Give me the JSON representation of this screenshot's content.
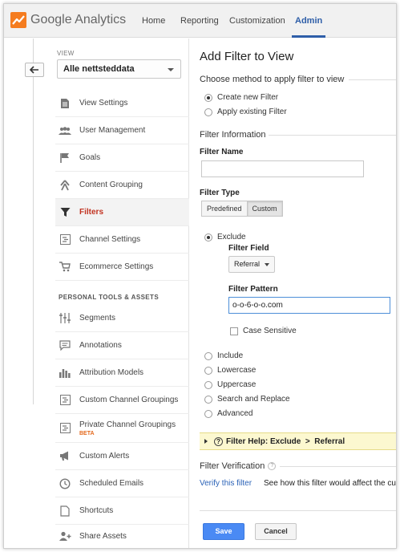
{
  "header": {
    "logo_text": "Google Analytics",
    "nav": [
      {
        "label": "Home"
      },
      {
        "label": "Reporting"
      },
      {
        "label": "Customization"
      },
      {
        "label": "Admin"
      }
    ],
    "active_nav": "Admin"
  },
  "sidebar": {
    "view_label": "VIEW",
    "view_value": "Alle nettsteddata",
    "items": [
      {
        "label": "View Settings",
        "icon": "document-icon"
      },
      {
        "label": "User Management",
        "icon": "users-icon"
      },
      {
        "label": "Goals",
        "icon": "flag-icon"
      },
      {
        "label": "Content Grouping",
        "icon": "person-walk-icon"
      },
      {
        "label": "Filters",
        "icon": "filter-icon"
      },
      {
        "label": "Channel Settings",
        "icon": "channel-icon"
      },
      {
        "label": "Ecommerce Settings",
        "icon": "cart-icon"
      }
    ],
    "section_title": "PERSONAL TOOLS & ASSETS",
    "personal_items": [
      {
        "label": "Segments",
        "icon": "segments-icon"
      },
      {
        "label": "Annotations",
        "icon": "comment-icon"
      },
      {
        "label": "Attribution Models",
        "icon": "bar-chart-icon"
      },
      {
        "label": "Custom Channel Groupings",
        "icon": "channel-icon"
      },
      {
        "label": "Private Channel Groupings",
        "icon": "channel-icon",
        "badge": "BETA"
      },
      {
        "label": "Custom Alerts",
        "icon": "megaphone-icon"
      },
      {
        "label": "Scheduled Emails",
        "icon": "clock-icon"
      },
      {
        "label": "Shortcuts",
        "icon": "shortcut-icon"
      },
      {
        "label": "Share Assets",
        "icon": "share-user-icon"
      }
    ]
  },
  "main": {
    "title": "Add Filter to View",
    "method_heading": "Choose method to apply filter to view",
    "method_options": [
      "Create new Filter",
      "Apply existing Filter"
    ],
    "method_selected": "Create new Filter",
    "info_heading": "Filter Information",
    "filter_name_label": "Filter Name",
    "filter_name_value": "",
    "filter_type_label": "Filter Type",
    "filter_type_tabs": [
      "Predefined",
      "Custom"
    ],
    "filter_type_selected": "Custom",
    "custom_options": [
      "Exclude",
      "Include",
      "Lowercase",
      "Uppercase",
      "Search and Replace",
      "Advanced"
    ],
    "custom_selected": "Exclude",
    "filter_field_label": "Filter Field",
    "filter_field_value": "Referral",
    "filter_pattern_label": "Filter Pattern",
    "filter_pattern_value": "o-o-6-o-o.com",
    "case_sensitive_label": "Case Sensitive",
    "case_sensitive": false,
    "help_bar": "Filter Help: Exclude  >  Referral",
    "verification_heading": "Filter Verification",
    "verify_link": "Verify this filter",
    "verify_desc": "See how this filter would affect the current",
    "save_label": "Save",
    "cancel_label": "Cancel"
  },
  "colors": {
    "accent_blue": "#2e5ea8",
    "active_red": "#c23321",
    "save_blue": "#4a8af4",
    "help_yellow": "#fcf8d0"
  }
}
